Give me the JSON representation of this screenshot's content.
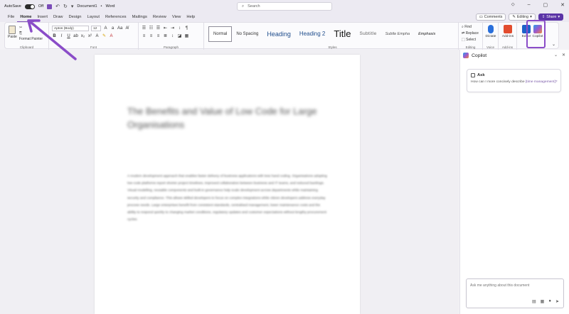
{
  "titlebar": {
    "autosave_label": "AutoSave",
    "autosave_state": "Off",
    "doc_name": "Document1",
    "app_name": "Word",
    "search_placeholder": "Search"
  },
  "menu": {
    "tabs": [
      "File",
      "Home",
      "Insert",
      "Draw",
      "Design",
      "Layout",
      "References",
      "Mailings",
      "Review",
      "View",
      "Help"
    ],
    "active": "Home",
    "comments_label": "Comments",
    "editing_label": "Editing",
    "share_label": "Share"
  },
  "ribbon": {
    "paste_label": "Paste",
    "format_painter_label": "Format Painter",
    "clipboard_label": "Clipboard",
    "font_name": "Aptos (Body)",
    "font_size": "12",
    "font_label": "Font",
    "paragraph_label": "Paragraph",
    "styles": [
      "Normal",
      "No Spacing",
      "Heading",
      "Heading 2",
      "Title",
      "Subtitle",
      "Subtle Empha",
      "Emphasis"
    ],
    "styles_label": "Styles",
    "find_label": "Find",
    "replace_label": "Replace",
    "select_label": "Select",
    "editing_group_label": "Editing",
    "dictate_label": "Dictate",
    "voice_label": "Voice",
    "addins_label": "Add-ins",
    "addins_group_label": "Add-ins",
    "editor_label": "Editor",
    "copilot_label": "Copilot"
  },
  "document": {
    "title": "The Benefits and Value of Low Code for Large Organisations",
    "body": "A modern development approach that enables faster delivery of business applications with less hand coding. Organisations adopting low code platforms report shorter project timelines, improved collaboration between business and IT teams, and reduced backlogs. Visual modelling, reusable components and built-in governance help scale development across departments while maintaining security and compliance. This allows skilled developers to focus on complex integrations while citizen developers address everyday process needs. Large enterprises benefit from consistent standards, centralised management, lower maintenance costs and the ability to respond quickly to changing market conditions, regulatory updates and customer expectations without lengthy procurement cycles."
  },
  "copilot": {
    "title": "Copilot",
    "ask_label": "Ask",
    "ask_text_prefix": "How can I more concisely describe",
    "ask_text_highlight": "[time management]?",
    "input_placeholder": "Ask me anything about this document"
  },
  "colors": {
    "accent": "#7b4cb8",
    "annotation": "#8a4cc8",
    "share_button": "#5b34a6"
  }
}
